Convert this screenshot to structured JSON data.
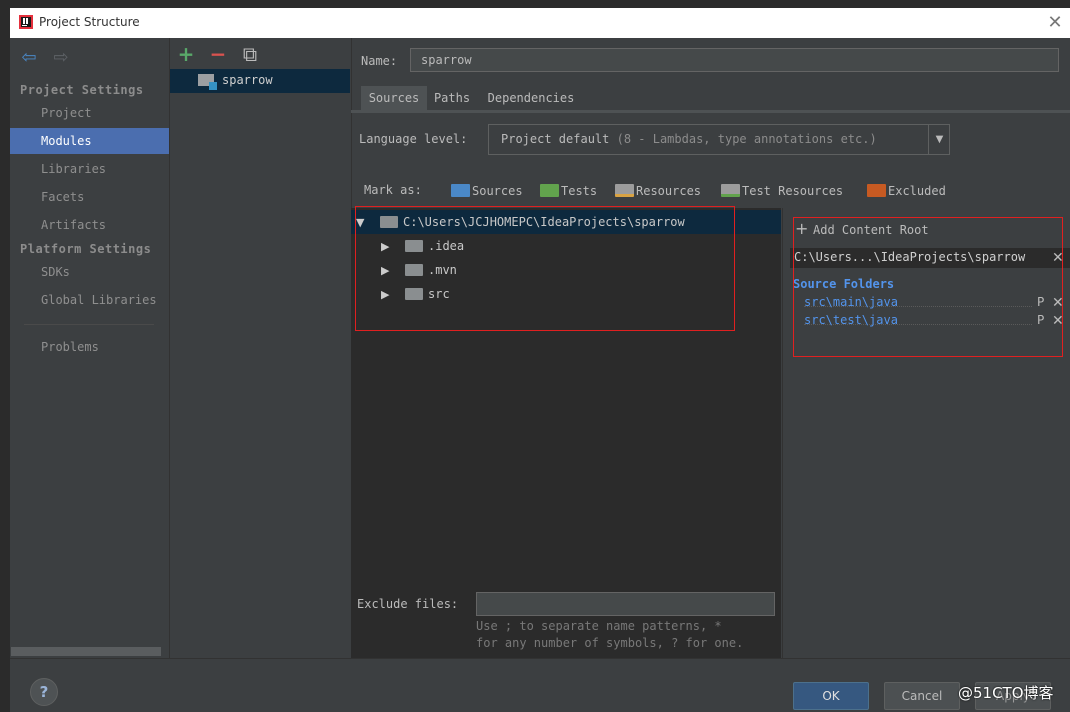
{
  "window": {
    "title": "Project Structure",
    "close_glyph": "✕"
  },
  "colors": {
    "accent": "#4b6eaf",
    "selection": "#0d293e",
    "link": "#5394ec",
    "sources": "#4a88c7",
    "tests": "#62a34d",
    "resources": "#9c9c9c",
    "excluded": "#c75a22",
    "highlight_box": "#e02020"
  },
  "nav": {
    "back_icon": "⇦",
    "forward_icon": "⇨"
  },
  "sidebar": {
    "project_settings_header": "Project Settings",
    "platform_settings_header": "Platform Settings",
    "items": [
      {
        "label": "Project",
        "selected": false
      },
      {
        "label": "Modules",
        "selected": true
      },
      {
        "label": "Libraries",
        "selected": false
      },
      {
        "label": "Facets",
        "selected": false
      },
      {
        "label": "Artifacts",
        "selected": false
      },
      {
        "label": "SDKs",
        "selected": false
      },
      {
        "label": "Global Libraries",
        "selected": false
      },
      {
        "label": "Problems",
        "selected": false
      }
    ]
  },
  "modules_toolbar": {
    "add_icon": "+",
    "remove_icon": "−",
    "copy_icon": "⧉"
  },
  "modules": [
    {
      "label": "sparrow",
      "selected": true
    }
  ],
  "module": {
    "name_label": "Name:",
    "name_value": "sparrow",
    "tabs": [
      {
        "label": "Sources",
        "selected": true
      },
      {
        "label": "Paths",
        "selected": false
      },
      {
        "label": "Dependencies",
        "selected": false
      }
    ],
    "language_level_label": "Language level:",
    "language_level_value": "Project default",
    "language_level_detail": "(8 - Lambdas, type annotations etc.)",
    "combo_arrow": "▼",
    "mark_as_label": "Mark as:",
    "mark_as": [
      {
        "label": "Sources"
      },
      {
        "label": "Tests"
      },
      {
        "label": "Resources"
      },
      {
        "label": "Test Resources"
      },
      {
        "label": "Excluded"
      }
    ]
  },
  "tree": {
    "root": "C:\\Users\\JCJHOMEPC\\IdeaProjects\\sparrow",
    "expand_glyph": "▼",
    "collapse_glyph": "▶",
    "children": [
      ".idea",
      ".mvn",
      "src"
    ]
  },
  "content_root": {
    "add_label": "Add Content Root",
    "plus_glyph": "+",
    "path": "C:\\Users...\\IdeaProjects\\sparrow",
    "remove_glyph": "✕",
    "source_folders_header": "Source Folders",
    "source_folders": [
      "src\\main\\java",
      "src\\test\\java"
    ],
    "props_glyph": "P"
  },
  "exclude": {
    "label": "Exclude files:",
    "value": "",
    "hint_line1": "Use ; to separate name patterns, *",
    "hint_line2": "for any number of symbols, ? for one."
  },
  "footer": {
    "help_glyph": "?",
    "ok_label": "OK",
    "cancel_label": "Cancel",
    "apply_label": "Apply",
    "watermark": "@51CTO博客"
  }
}
